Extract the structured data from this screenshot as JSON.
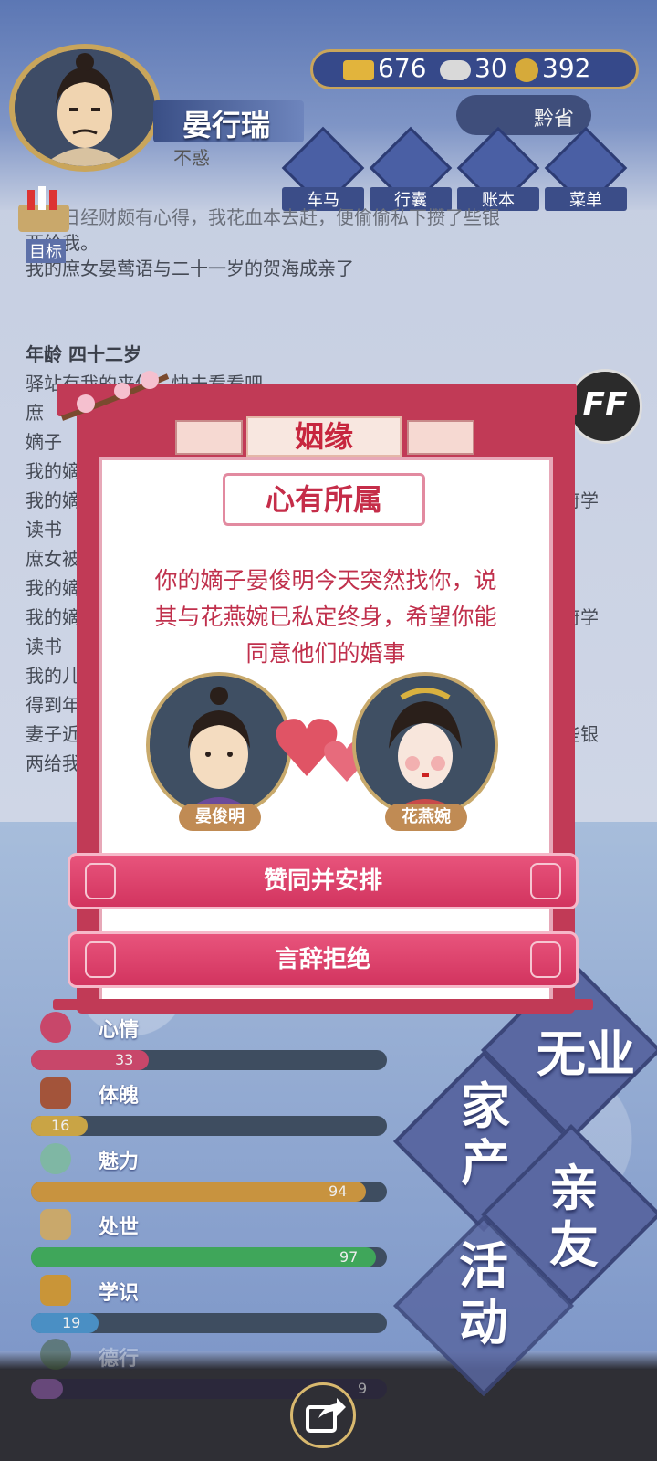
{
  "player": {
    "name": "晏行瑞",
    "age_title": "不惑",
    "region": "黔省"
  },
  "resources": {
    "gold": "676",
    "silver": "30",
    "coins": "392"
  },
  "menu": [
    {
      "label": "车马",
      "icon": "carriage-icon"
    },
    {
      "label": "行囊",
      "icon": "bag-icon"
    },
    {
      "label": "账本",
      "icon": "ledger-icon"
    },
    {
      "label": "菜单",
      "icon": "more-icon"
    }
  ],
  "goal_label": "目标",
  "log": {
    "line1": "…近日经财颇有心得，我花血本去赶，便偷偷私下攒了些银",
    "line2": "两给我。",
    "line3": "我的庶女晏莺语与二十一岁的贺海成亲了",
    "age_header": "年龄 四十二岁",
    "lines": [
      "驿站有我的来信，快去看看吧",
      "庶",
      "嫡子",
      "我的嫡",
      "我的嫡",
      "读书",
      "庶女被",
      "我的嫡",
      "我的嫡",
      "读书",
      "我的儿",
      "得到年",
      "妻子近",
      "两给我"
    ],
    "right_fragments": [
      "府学",
      "府学",
      "些银"
    ]
  },
  "dialog": {
    "title": "姻缘",
    "subtitle": "心有所属",
    "message_lines": [
      "你的嫡子晏俊明今天突然找你，说",
      "其与花燕婉已私定终身，希望你能",
      "同意他们的婚事"
    ],
    "person_left": "晏俊明",
    "person_right": "花燕婉",
    "accept": "赞同并安排",
    "reject": "言辞拒绝"
  },
  "ff_label": "FF",
  "stats": [
    {
      "label": "心情",
      "value": "33",
      "percent": 33,
      "color": "#c8476a",
      "icon": "flower-icon"
    },
    {
      "label": "体魄",
      "value": "16",
      "percent": 16,
      "color": "#c9a445",
      "icon": "weight-icon"
    },
    {
      "label": "魅力",
      "value": "94",
      "percent": 94,
      "color": "#c8933f",
      "icon": "mirror-icon"
    },
    {
      "label": "处世",
      "value": "97",
      "percent": 97,
      "color": "#3fa65a",
      "icon": "shoe-icon"
    },
    {
      "label": "学识",
      "value": "19",
      "percent": 19,
      "color": "#4a8fc4",
      "icon": "desk-icon"
    },
    {
      "label": "德行",
      "value": "9",
      "percent": 9,
      "color": "#8d5aa8",
      "icon": "vase-icon"
    }
  ],
  "actions": {
    "career": "无业",
    "property": "家产",
    "relatives": "亲友",
    "activity": "活动"
  }
}
